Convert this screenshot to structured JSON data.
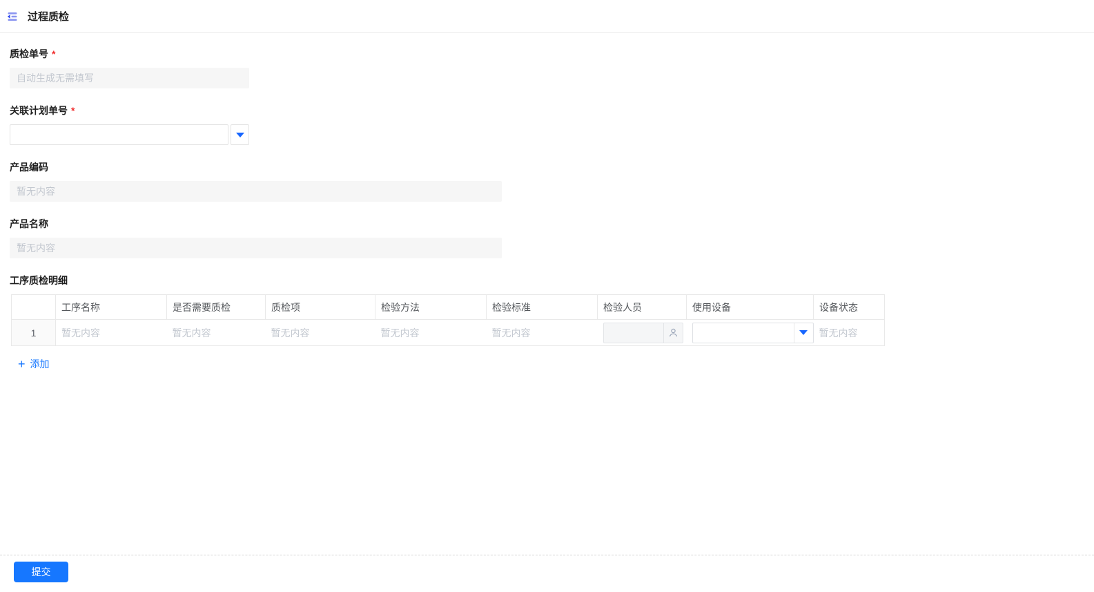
{
  "header": {
    "title": "过程质检"
  },
  "form": {
    "required_mark": "*",
    "qc_no": {
      "label": "质检单号",
      "placeholder": "自动生成无需填写",
      "value": ""
    },
    "plan_no": {
      "label": "关联计划单号",
      "value": ""
    },
    "product_code": {
      "label": "产品编码",
      "placeholder": "暂无内容",
      "value": ""
    },
    "product_name": {
      "label": "产品名称",
      "placeholder": "暂无内容",
      "value": ""
    }
  },
  "detail": {
    "section_label": "工序质检明细",
    "columns": [
      "",
      "工序名称",
      "是否需要质检",
      "质检项",
      "检验方法",
      "检验标准",
      "检验人员",
      "使用设备",
      "设备状态"
    ],
    "row": {
      "index": "1",
      "process_name": "暂无内容",
      "need_qc": "暂无内容",
      "qc_item": "暂无内容",
      "method": "暂无内容",
      "standard": "暂无内容",
      "inspector": "",
      "equipment": "",
      "equipment_status": "暂无内容"
    },
    "add_icon": "+",
    "add_label": "添加"
  },
  "footer": {
    "submit_label": "提交"
  },
  "colors": {
    "accent": "#1677ff",
    "required_mark": "#f02b2b",
    "placeholder_text": "#c2c7cf",
    "icon_bars": "#8a94f0",
    "icon_arrow": "#2b46f0"
  }
}
